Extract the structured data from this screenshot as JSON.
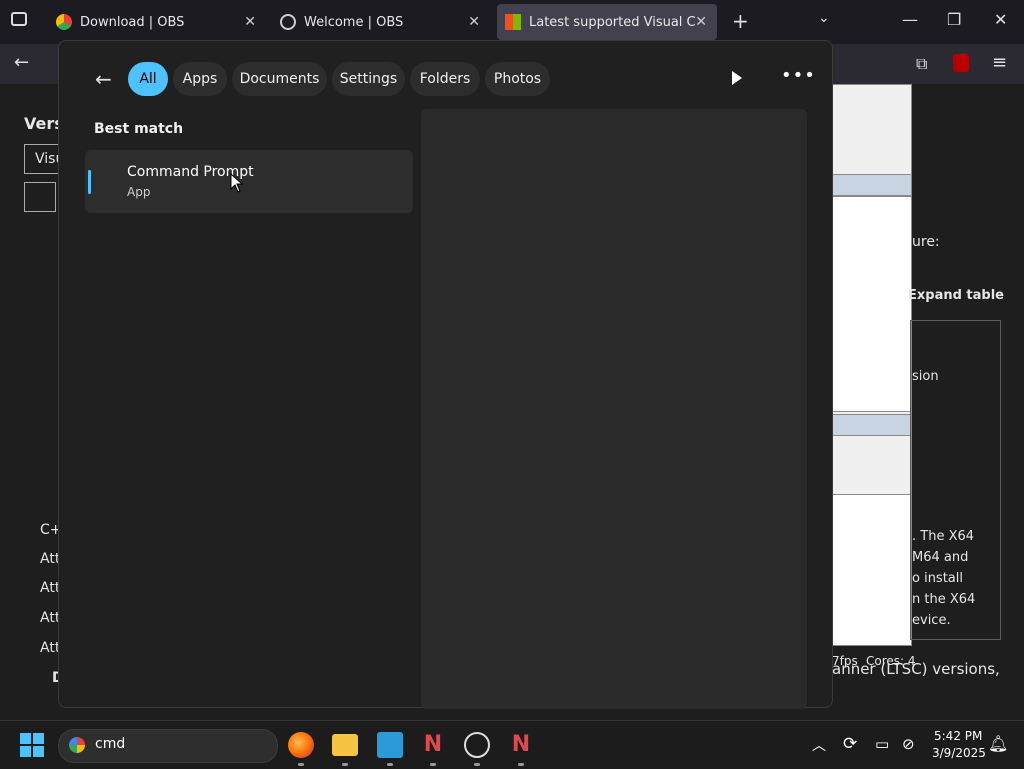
{
  "browser": {
    "tabs": [
      {
        "label": "Download | OBS",
        "icon": "chrome-icon"
      },
      {
        "label": "Welcome | OBS",
        "icon": "obs-icon"
      },
      {
        "label": "Latest supported Visual C++ Re",
        "icon": "microsoft-icon"
      }
    ],
    "new_tab": "+"
  },
  "page": {
    "left_texts": [
      "Versi",
      "Visu",
      "C+",
      "Att",
      "Att",
      "Att",
      "Att",
      "D"
    ],
    "right_texts": [
      "ure:",
      "Expand table",
      "sion",
      ". The X64",
      "M64 and",
      "o install",
      "n the X64",
      "evice.",
      "anner (LTSC) versions,"
    ],
    "fps_text": "7fps",
    "cores_text": "Cores: 4"
  },
  "search_flyout": {
    "filters": [
      "All",
      "Apps",
      "Documents",
      "Settings",
      "Folders",
      "Photos"
    ],
    "selected_filter": "All",
    "best_match_label": "Best match",
    "result": {
      "title": "Command Prompt",
      "subtitle": "App"
    }
  },
  "taskbar": {
    "search_query": "cmd",
    "time": "5:42 PM",
    "date": "3/9/2025"
  },
  "colors": {
    "accent": "#4cc2ff",
    "flyout_bg": "#202020",
    "taskbar_bg": "#1c1c1c"
  }
}
